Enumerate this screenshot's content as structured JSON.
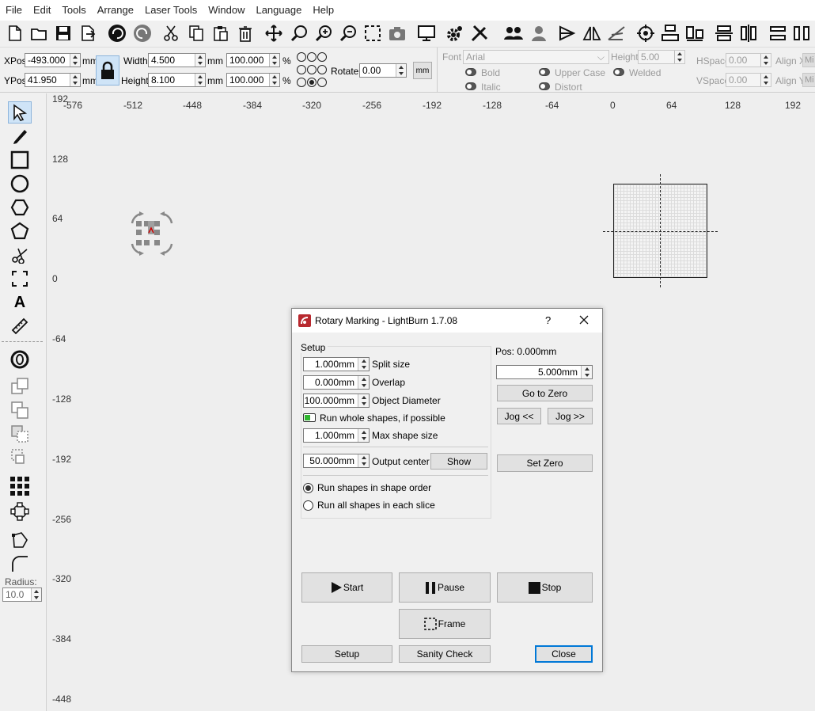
{
  "menu": [
    "File",
    "Edit",
    "Tools",
    "Arrange",
    "Laser Tools",
    "Window",
    "Language",
    "Help"
  ],
  "props": {
    "xpos_label": "XPos",
    "xpos": "-493.000",
    "ypos_label": "YPos",
    "ypos": "41.950",
    "unit_mm": "mm",
    "width_label": "Width",
    "width": "4.500",
    "height_label": "Height",
    "height": "8.100",
    "scale_w": "100.000",
    "scale_h": "100.000",
    "pct": "%",
    "rotate_label": "Rotate",
    "rotate": "0.00",
    "mm_button": "mm",
    "font_label": "Font",
    "font": "Arial",
    "text_height_label": "Height",
    "text_height": "5.00",
    "hspace_label": "HSpace",
    "hspace": "0.00",
    "vspace_label": "VSpace",
    "vspace": "0.00",
    "alignx_label": "Align X",
    "aligny_label": "Align Y",
    "alignx": "Mi",
    "aligny": "Mi",
    "bold": "Bold",
    "italic": "Italic",
    "upper_case": "Upper Case",
    "distort": "Distort",
    "welded": "Welded"
  },
  "left": {
    "radius_label": "Radius:",
    "radius": "10.0"
  },
  "ruler": {
    "x": [
      "-576",
      "-512",
      "-448",
      "-384",
      "-320",
      "-256",
      "-192",
      "-128",
      "-64",
      "0",
      "64",
      "128",
      "192"
    ],
    "y": [
      "192",
      "128",
      "64",
      "0",
      "-64",
      "-128",
      "-192",
      "-256",
      "-320",
      "-384",
      "-448"
    ]
  },
  "dialog": {
    "title": "Rotary Marking - LightBurn 1.7.08",
    "help": "?",
    "setup_group": "Setup",
    "split_size": "1.000mm",
    "split_size_label": "Split size",
    "overlap": "0.000mm",
    "overlap_label": "Overlap",
    "diameter": "100.000mm",
    "diameter_label": "Object Diameter",
    "run_whole": "Run whole shapes, if possible",
    "max_shape": "1.000mm",
    "max_shape_label": "Max shape size",
    "output_center": "50.000mm",
    "output_center_label": "Output center",
    "show": "Show",
    "radio1": "Run shapes in shape order",
    "radio2": "Run all shapes in each slice",
    "pos": "Pos: 0.000mm",
    "jog_step": "5.000mm",
    "go_zero": "Go to Zero",
    "jog_left": "Jog <<",
    "jog_right": "Jog >>",
    "set_zero": "Set Zero",
    "start": "Start",
    "pause": "Pause",
    "stop": "Stop",
    "frame": "Frame",
    "setup": "Setup",
    "sanity": "Sanity Check",
    "close": "Close"
  }
}
